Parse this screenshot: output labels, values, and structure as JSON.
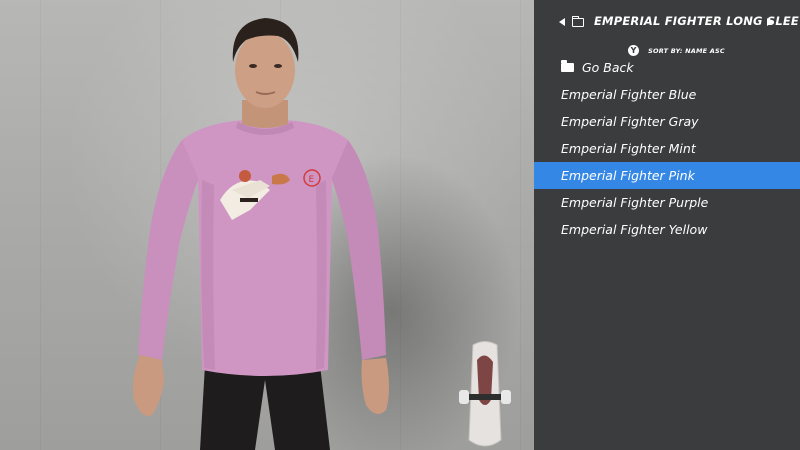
{
  "header": {
    "title": "EMPERIAL FIGHTER LONG SLEEVE",
    "left_arrow_icon": "chevron-left-icon",
    "right_arrow_icon": "chevron-right-icon",
    "folder_icon": "folder-icon"
  },
  "sort": {
    "button_glyph": "Y",
    "label": "SORT BY: NAME ASC"
  },
  "list": {
    "go_back": "Go Back",
    "items": [
      "Emperial Fighter Blue",
      "Emperial Fighter Gray",
      "Emperial Fighter Mint",
      "Emperial Fighter Pink",
      "Emperial Fighter Purple",
      "Emperial Fighter Yellow"
    ],
    "selected_index": 3
  },
  "colors": {
    "panel_bg": "#3b3c3d",
    "selection": "#3487e4",
    "shirt": "#cf95c3",
    "text": "#ffffff"
  }
}
